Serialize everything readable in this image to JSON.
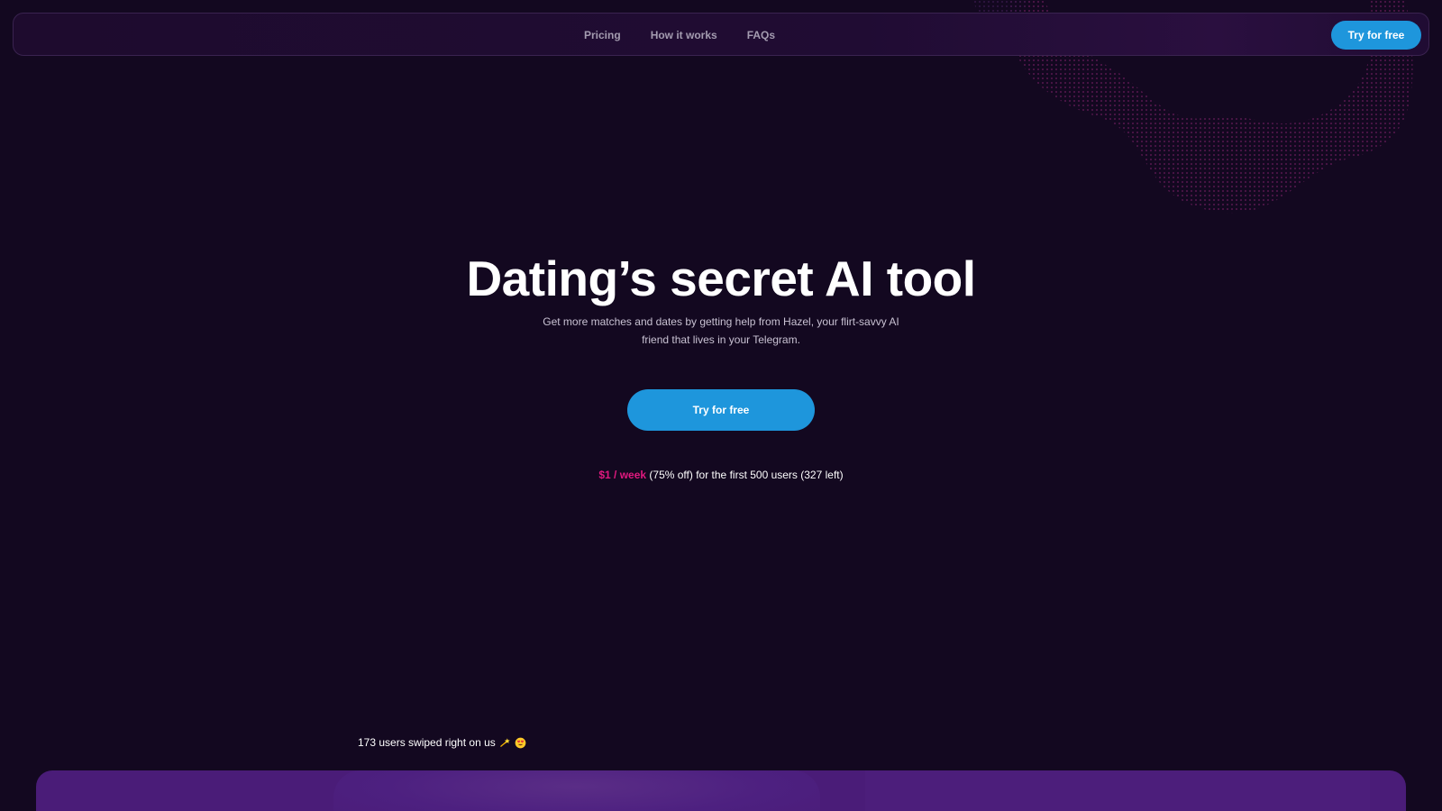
{
  "theme": {
    "background": "#130820",
    "accent": "#1e96dc",
    "highlight": "#e0197f",
    "panel": "#4a1c78"
  },
  "nav": {
    "links": [
      "Pricing",
      "How it works",
      "FAQs"
    ],
    "cta_label": "Try for free"
  },
  "hero": {
    "title": "Dating’s secret AI tool",
    "subtitle_line1": "Get more matches and dates by getting help from  Hazel, your flirt-savvy AI",
    "subtitle_line2": "friend that lives in your Telegram.",
    "cta_label": "Try for free"
  },
  "offer": {
    "price": "$1 / week",
    "details": " (75% off) for the first 500 users (327 left)"
  },
  "social_proof": {
    "text": "173 users swiped right on us",
    "icons": [
      "dizzy-star-icon",
      "heart-eyes-emoji-icon"
    ]
  }
}
